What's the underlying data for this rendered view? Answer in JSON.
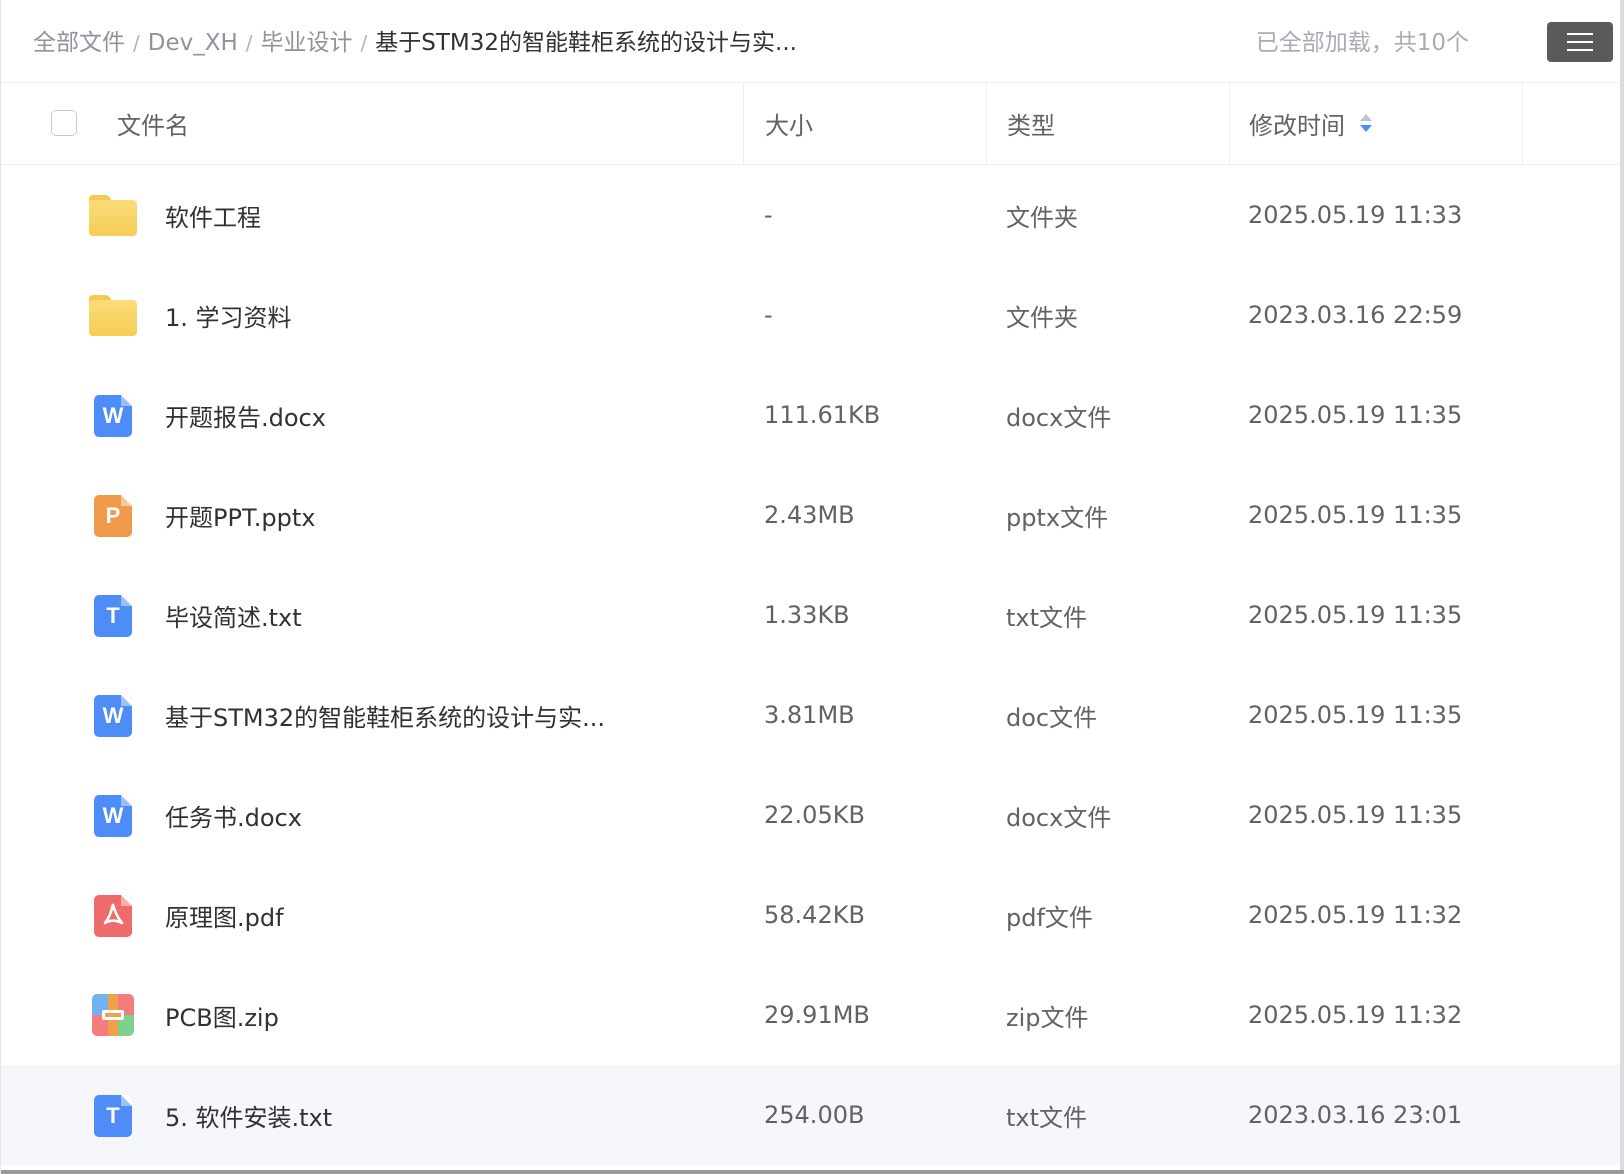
{
  "breadcrumb": [
    {
      "label": "全部文件",
      "current": false
    },
    {
      "label": "Dev_XH",
      "current": false
    },
    {
      "label": "毕业设计",
      "current": false
    },
    {
      "label": "基于STM32的智能鞋柜系统的设计与实...",
      "current": true
    }
  ],
  "breadcrumb_separator": "/",
  "load_status": "已全部加载，共10个",
  "menu_button": {
    "icon": "hamburger-menu-icon"
  },
  "columns": {
    "name": "文件名",
    "size": "大小",
    "type": "类型",
    "modified": "修改时间"
  },
  "sort": {
    "column": "modified",
    "direction": "descending"
  },
  "colors": {
    "folder": "#f6cd55",
    "word": "#4e8cf7",
    "ppt": "#f29a4b",
    "txt": "#4e8cf7",
    "pdf": "#ee6b6b",
    "sort_active": "#4e8cf7",
    "menu_button": "#5a5a5a"
  },
  "rows": [
    {
      "icon": "folder-icon",
      "name": "软件工程",
      "size": "-",
      "type": "文件夹",
      "modified": "2025.05.19 11:33"
    },
    {
      "icon": "folder-icon",
      "name": "1. 学习资料",
      "size": "-",
      "type": "文件夹",
      "modified": "2023.03.16 22:59"
    },
    {
      "icon": "word-file-icon",
      "name": "开题报告.docx",
      "size": "111.61KB",
      "type": "docx文件",
      "modified": "2025.05.19 11:35"
    },
    {
      "icon": "ppt-file-icon",
      "name": "开题PPT.pptx",
      "size": "2.43MB",
      "type": "pptx文件",
      "modified": "2025.05.19 11:35"
    },
    {
      "icon": "txt-file-icon",
      "name": "毕设简述.txt",
      "size": "1.33KB",
      "type": "txt文件",
      "modified": "2025.05.19 11:35"
    },
    {
      "icon": "word-file-icon",
      "name": "基于STM32的智能鞋柜系统的设计与实...",
      "size": "3.81MB",
      "type": "doc文件",
      "modified": "2025.05.19 11:35"
    },
    {
      "icon": "word-file-icon",
      "name": "任务书.docx",
      "size": "22.05KB",
      "type": "docx文件",
      "modified": "2025.05.19 11:35"
    },
    {
      "icon": "pdf-file-icon",
      "name": "原理图.pdf",
      "size": "58.42KB",
      "type": "pdf文件",
      "modified": "2025.05.19 11:32"
    },
    {
      "icon": "zip-file-icon",
      "name": "PCB图.zip",
      "size": "29.91MB",
      "type": "zip文件",
      "modified": "2025.05.19 11:32"
    },
    {
      "icon": "txt-file-icon",
      "name": "5. 软件安装.txt",
      "size": "254.00B",
      "type": "txt文件",
      "modified": "2023.03.16 23:01",
      "hovered": true
    }
  ]
}
